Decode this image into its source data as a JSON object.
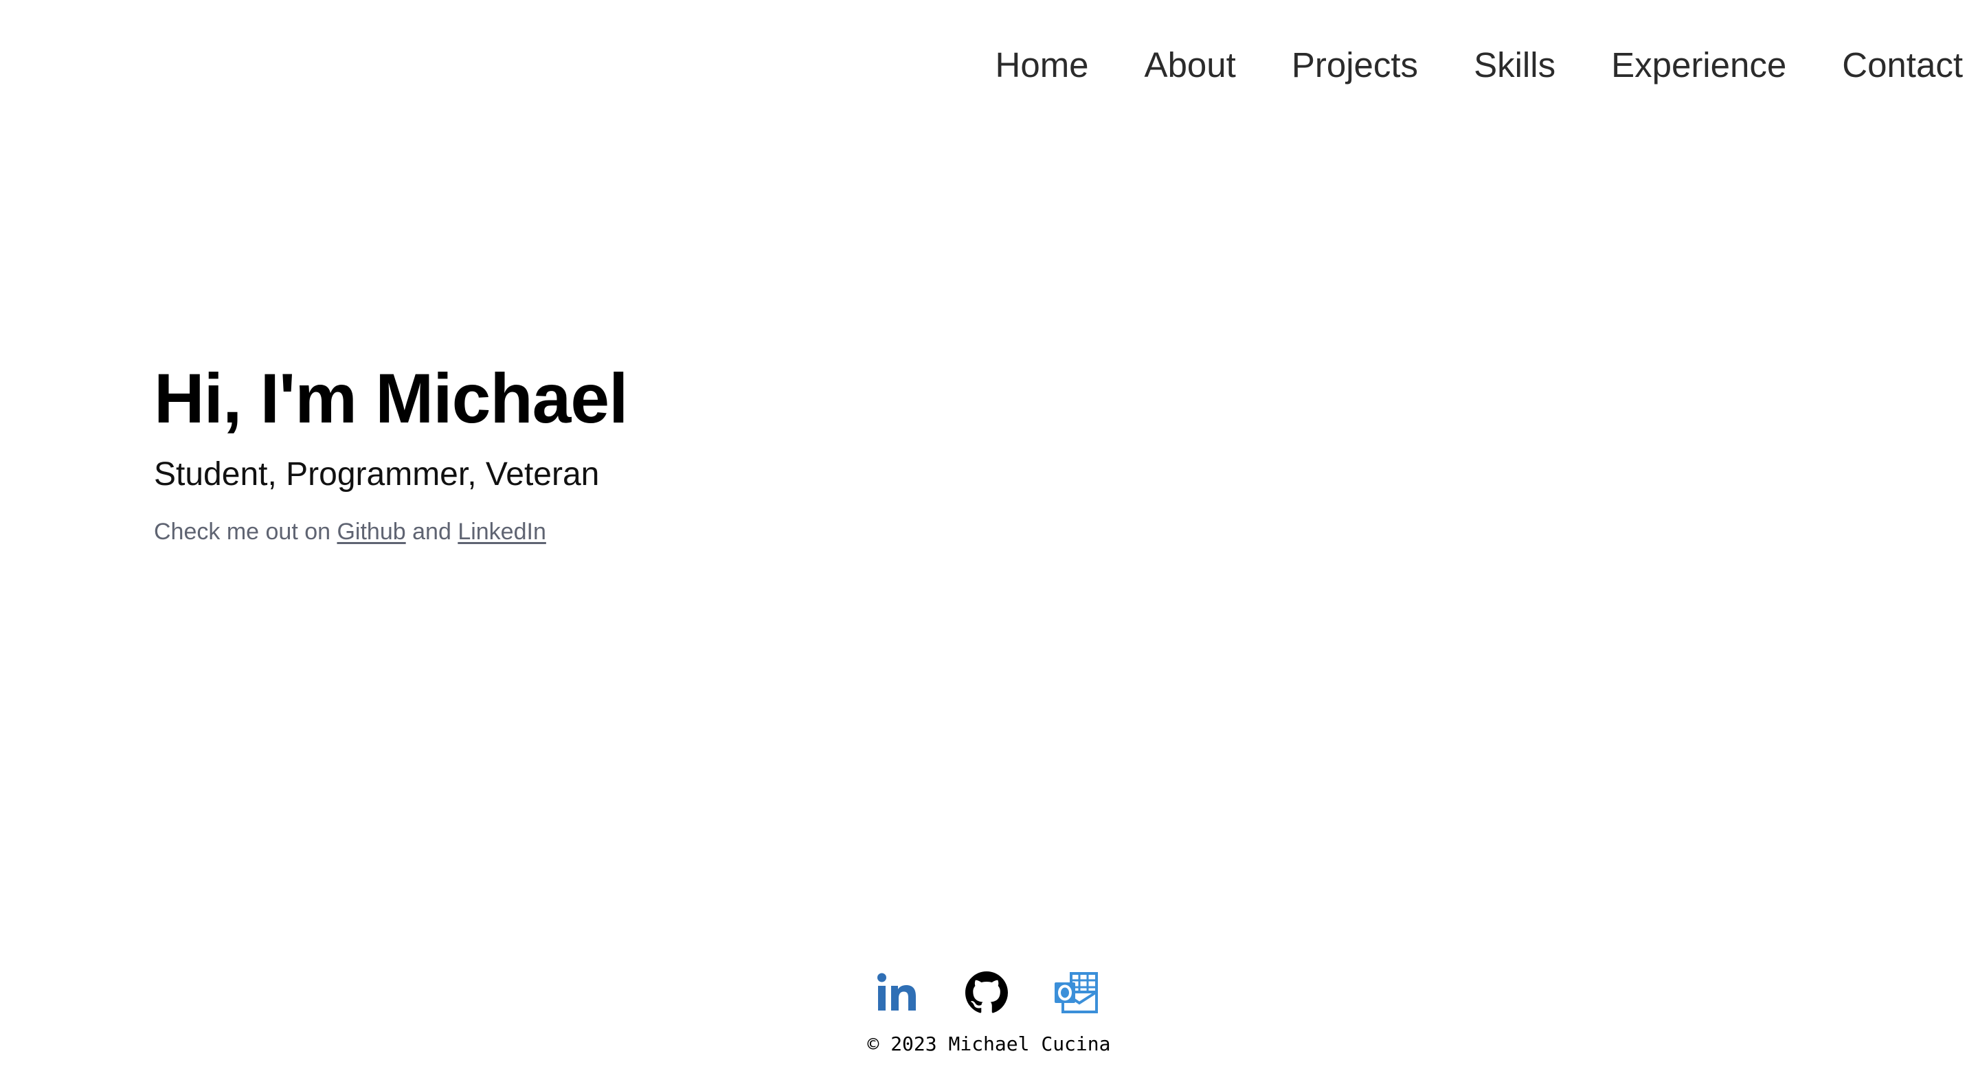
{
  "nav": {
    "items": [
      {
        "label": "Home"
      },
      {
        "label": "About"
      },
      {
        "label": "Projects"
      },
      {
        "label": "Skills"
      },
      {
        "label": "Experience"
      },
      {
        "label": "Contact"
      }
    ]
  },
  "hero": {
    "title": "Hi, I'm Michael",
    "subtitle": "Student, Programmer, Veteran",
    "cta_prefix": "Check me out on",
    "github_link": "Github",
    "cta_joiner": "and",
    "linkedin_link": "LinkedIn"
  },
  "footer": {
    "icons": [
      {
        "icon": "linkedin-icon",
        "color": "#2f6fb5"
      },
      {
        "icon": "github-icon",
        "color": "#000000"
      },
      {
        "icon": "outlook-mail-icon",
        "color": "#3b8fd9"
      }
    ],
    "copyright": "© 2023 Michael Cucina"
  },
  "colors": {
    "nav_text": "#2b2b2b",
    "muted_text": "#5f6472",
    "linkedin_blue": "#2f6fb5",
    "outlook_blue": "#3b8fd9"
  }
}
